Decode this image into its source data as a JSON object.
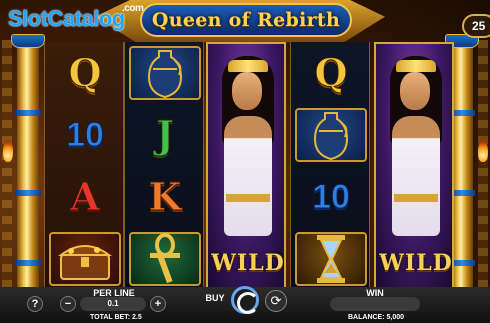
{
  "watermark": {
    "brand": "SlotCatalog",
    "tld": ".com"
  },
  "game": {
    "title": "Queen of Rebirth",
    "lines": "25"
  },
  "reels": [
    {
      "symbols": [
        "Q",
        "10",
        "A",
        "treasure-chest"
      ]
    },
    {
      "symbols": [
        "vase",
        "J",
        "K",
        "ankh"
      ]
    },
    {
      "symbols": [
        "queen-wild"
      ],
      "wild_label": "WILD"
    },
    {
      "symbols": [
        "Q",
        "vase",
        "10",
        "hourglass"
      ]
    },
    {
      "symbols": [
        "queen-wild"
      ],
      "wild_label": "WILD"
    }
  ],
  "bar": {
    "help": "?",
    "per_line_label": "PER LINE",
    "per_line_value": "0.1",
    "minus": "−",
    "plus": "+",
    "total_bet": "TOTAL BET: 2.5",
    "buy": "BUY",
    "win_label": "WIN",
    "balance": "BALANCE: 5,000",
    "autoplay_icon": "⟳"
  }
}
